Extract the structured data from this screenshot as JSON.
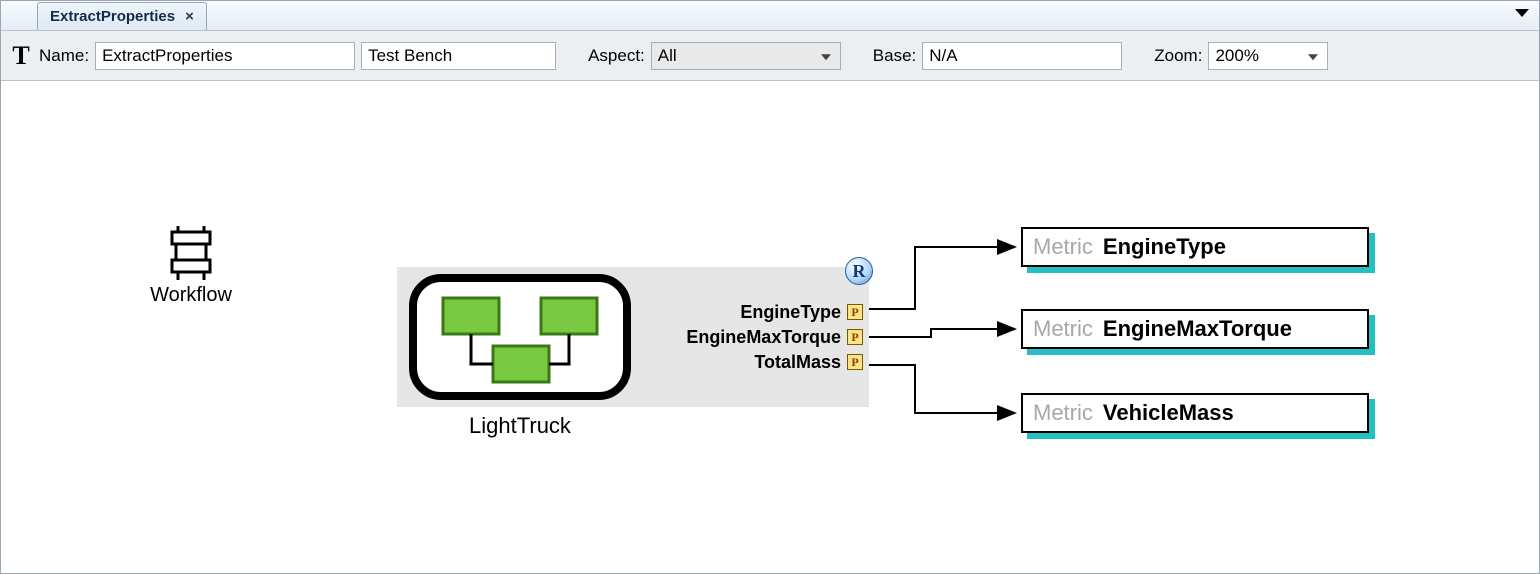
{
  "tab": {
    "title": "ExtractProperties",
    "close_glyph": "×"
  },
  "toolbar": {
    "t_glyph": "T",
    "name_label": "Name:",
    "name_value": "ExtractProperties",
    "type_value": "Test Bench",
    "aspect_label": "Aspect:",
    "aspect_value": "All",
    "base_label": "Base:",
    "base_value": "N/A",
    "zoom_label": "Zoom:",
    "zoom_value": "200%"
  },
  "workflow": {
    "label": "Workflow"
  },
  "sut": {
    "label": "LightTruck",
    "badge_glyph": "R",
    "ports": [
      {
        "name": "EngineType",
        "pad_glyph": "P"
      },
      {
        "name": "EngineMaxTorque",
        "pad_glyph": "P"
      },
      {
        "name": "TotalMass",
        "pad_glyph": "P"
      }
    ]
  },
  "metrics": {
    "prefix": "Metric",
    "items": [
      {
        "name": "EngineType"
      },
      {
        "name": "EngineMaxTorque"
      },
      {
        "name": "VehicleMass"
      }
    ]
  }
}
